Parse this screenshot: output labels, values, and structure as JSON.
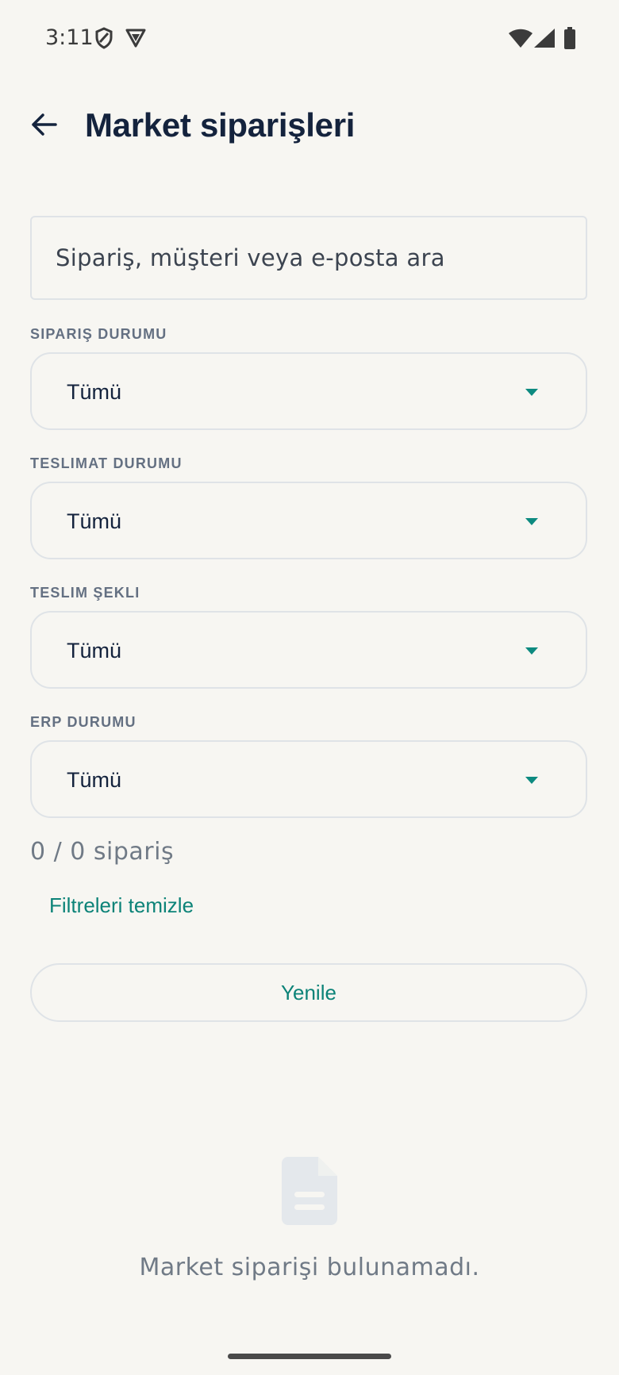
{
  "status_bar": {
    "time": "3:11",
    "icons": [
      "shield-icon",
      "vpn-icon",
      "wifi-icon",
      "cellular-signal-icon",
      "battery-icon"
    ]
  },
  "header": {
    "title": "Market siparişleri",
    "back_icon": "arrow-left-icon"
  },
  "search": {
    "placeholder": "Sipariş, müşteri veya e-posta ara",
    "value": ""
  },
  "filters": [
    {
      "label": "SIPARIŞ DURUMU",
      "value": "Tümü"
    },
    {
      "label": "TESLIMAT DURUMU",
      "value": "Tümü"
    },
    {
      "label": "TESLIM ŞEKLI",
      "value": "Tümü"
    },
    {
      "label": "ERP DURUMU",
      "value": "Tümü"
    }
  ],
  "results": {
    "count_text": "0 / 0 sipariş",
    "clear_filters_label": "Filtreleri temizle",
    "refresh_label": "Yenile"
  },
  "empty_state": {
    "icon": "document-icon",
    "message": "Market siparişi bulunamadı."
  },
  "colors": {
    "background": "#f7f6f2",
    "accent": "#0c8378",
    "title": "#14233d",
    "muted": "#707a86",
    "border": "#dfe3e7"
  }
}
